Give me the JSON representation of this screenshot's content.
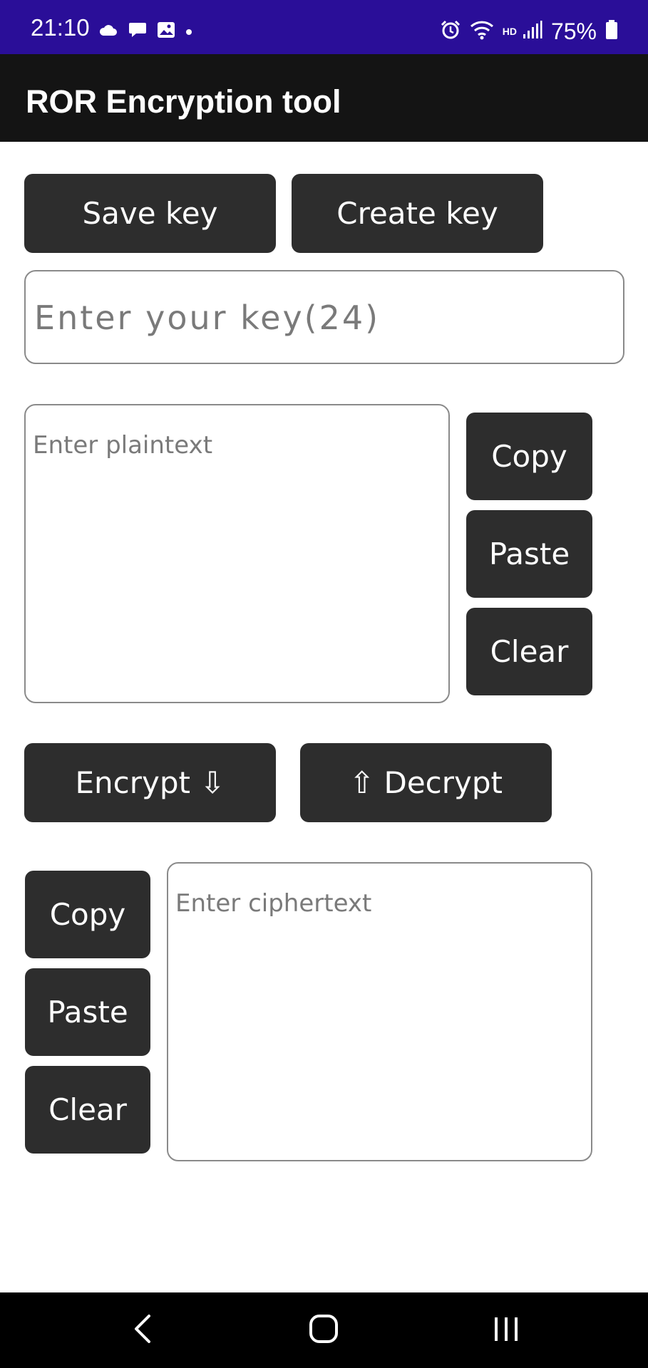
{
  "status_bar": {
    "time": "21:10",
    "network": "HD",
    "battery": "75%",
    "background": "#2a0e98",
    "left_icons": [
      "cloud-icon",
      "chat-icon",
      "image-icon",
      "dot-icon"
    ],
    "right_icons": [
      "alarm-icon",
      "wifi-icon",
      "signal-icon",
      "battery-icon"
    ]
  },
  "app_bar": {
    "title": "ROR Encryption tool"
  },
  "key_section": {
    "save_label": "Save key",
    "create_label": "Create key",
    "key_placeholder": "Enter your key(24)"
  },
  "plaintext": {
    "placeholder": "Enter plaintext",
    "copy_label": "Copy",
    "paste_label": "Paste",
    "clear_label": "Clear"
  },
  "actions": {
    "encrypt_label": "Encrypt ⇩",
    "decrypt_label": "⇧ Decrypt"
  },
  "ciphertext": {
    "placeholder": "Enter ciphertext",
    "copy_label": "Copy",
    "paste_label": "Paste",
    "clear_label": "Clear"
  },
  "nav_bar": {
    "icons": [
      "back-icon",
      "home-icon",
      "recents-icon"
    ]
  },
  "colors": {
    "button": "#2d2d2d",
    "app_bar": "#141414",
    "status_bar": "#2a0e98"
  }
}
